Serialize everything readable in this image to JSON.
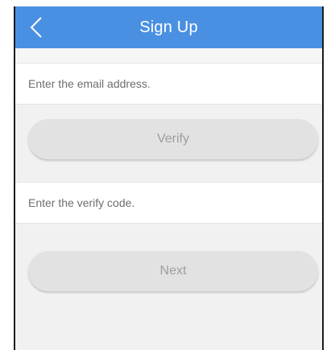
{
  "header": {
    "title": "Sign Up",
    "back_icon": "chevron-left-icon",
    "bg_color": "#4a90e2"
  },
  "email": {
    "placeholder": "Enter the email address.",
    "value": ""
  },
  "verify_button": {
    "label": "Verify"
  },
  "code": {
    "placeholder": "Enter the verify code.",
    "value": ""
  },
  "next_button": {
    "label": "Next"
  }
}
